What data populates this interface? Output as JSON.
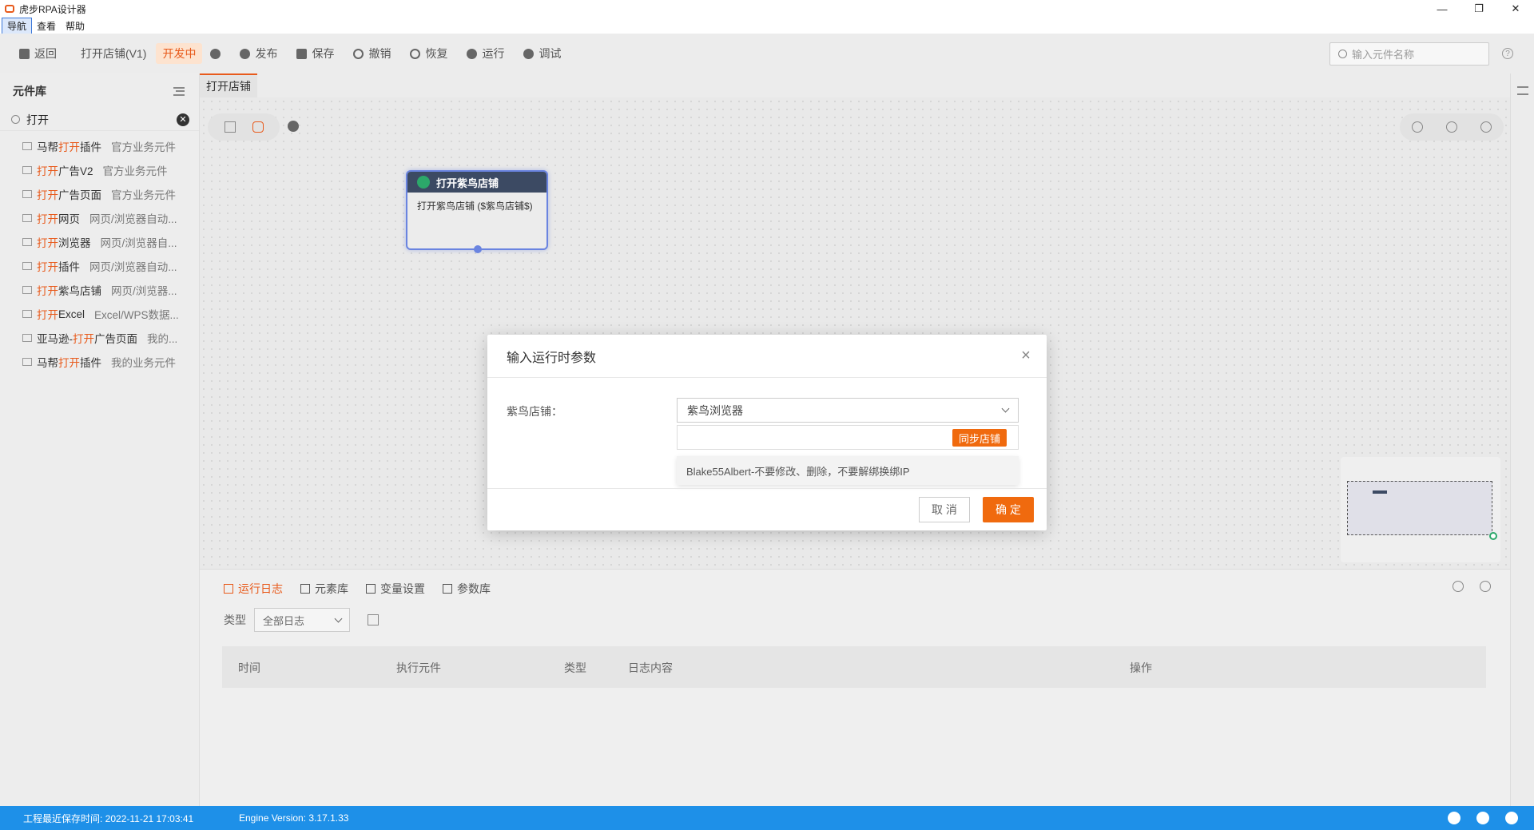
{
  "window": {
    "title": "虎步RPA设计器",
    "controls": [
      "—",
      "❐",
      "✕"
    ]
  },
  "menu": {
    "items": [
      "导航",
      "查看",
      "帮助"
    ]
  },
  "toolbar": {
    "back": "返回",
    "project": "打开店铺(V1)",
    "status_badge": "开发中",
    "publish": "发布",
    "save": "保存",
    "undo": "撤销",
    "redo": "恢复",
    "run": "运行",
    "debug": "调试",
    "search_placeholder": "输入元件名称"
  },
  "library": {
    "title": "元件库",
    "search_value": "打开",
    "items": [
      {
        "pre": "马帮",
        "hl": "打开",
        "post": "插件",
        "cat": "官方业务元件"
      },
      {
        "pre": "",
        "hl": "打开",
        "post": "广告V2",
        "cat": "官方业务元件"
      },
      {
        "pre": "",
        "hl": "打开",
        "post": "广告页面",
        "cat": "官方业务元件"
      },
      {
        "pre": "",
        "hl": "打开",
        "post": "网页",
        "cat": "网页/浏览器自动..."
      },
      {
        "pre": "",
        "hl": "打开",
        "post": "浏览器",
        "cat": "网页/浏览器自..."
      },
      {
        "pre": "",
        "hl": "打开",
        "post": "插件",
        "cat": "网页/浏览器自动..."
      },
      {
        "pre": "",
        "hl": "打开",
        "post": "紫鸟店铺",
        "cat": "网页/浏览器..."
      },
      {
        "pre": "",
        "hl": "打开",
        "post": "Excel",
        "cat": "Excel/WPS数据..."
      },
      {
        "pre": "亚马逊-",
        "hl": "打开",
        "post": "广告页面",
        "cat": "我的..."
      },
      {
        "pre": "马帮",
        "hl": "打开",
        "post": "插件",
        "cat": "我的业务元件"
      }
    ]
  },
  "tab": {
    "label": "打开店铺"
  },
  "node": {
    "title": "打开紫鸟店铺",
    "body": "打开紫鸟店铺 ($紫鸟店铺$)"
  },
  "bottom": {
    "tabs": [
      "运行日志",
      "元素库",
      "变量设置",
      "参数库"
    ],
    "filter_label": "类型",
    "filter_value": "全部日志",
    "columns": [
      "时间",
      "执行元件",
      "类型",
      "日志内容",
      "操作"
    ]
  },
  "status": {
    "saved": "工程最近保存时间: 2022-11-21 17:03:41",
    "engine": "Engine Version: 3.17.1.33"
  },
  "modal": {
    "title": "输入运行时参数",
    "field_label": "紫鸟店铺：",
    "dropdown_value": "紫鸟浏览器",
    "sync_button": "同步店铺",
    "option": "Blake55Albert-不要修改、删除，不要解绑换绑IP",
    "cancel": "取 消",
    "ok": "确 定"
  },
  "colors": {
    "accent": "#f06a0e",
    "statusbar": "#1e90e8",
    "node_header": "#3c4a63"
  }
}
